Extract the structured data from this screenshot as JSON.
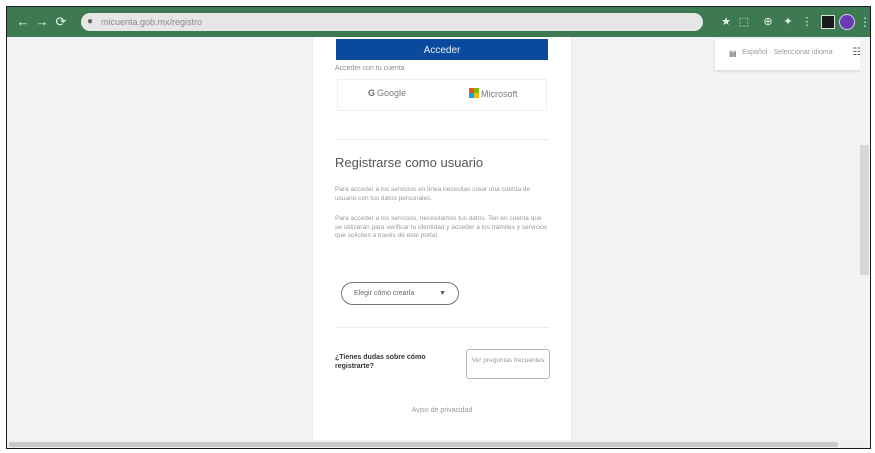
{
  "browser": {
    "url": "micuenta.gob.mx/registro",
    "nav": {
      "back": "←",
      "forward": "→",
      "reload": "⟳"
    },
    "lock_icon": "●",
    "toolbar_icons": [
      "★",
      "⬚",
      "⊕",
      "✦",
      "⋮"
    ]
  },
  "login": {
    "submit_label": "Acceder",
    "alt_label": "Acceder con tu cuenta",
    "google_label": "Google",
    "microsoft_label": "Microsoft"
  },
  "register": {
    "heading": "Registrarse como usuario",
    "paragraph1": "Para acceder a los servicios en línea necesitas crear una cuenta de usuario con tus datos personales.",
    "paragraph2": "Para acceder a los servicios, necesitamos tus datos. Ten en cuenta que se utilizarán para verificar tu identidad y acceder a los trámites y servicios que solicites a través de este portal.",
    "dropdown_label": "Elegir cómo crearla",
    "dropdown_caret": "▼"
  },
  "help": {
    "text": "¿Tienes dudas sobre cómo registrarte?",
    "button_label": "Ver preguntas frecuentes"
  },
  "footer": {
    "link_label": "Aviso de privacidad"
  },
  "language_popup": {
    "flag": "▤",
    "text": "Español · Seleccionar idioma",
    "action_icon": "☷"
  },
  "fab_icon": "?",
  "colors": {
    "toolbar": "#3d7a52",
    "primary_button": "#0a4a9e",
    "profile": "#6b3ab4"
  }
}
